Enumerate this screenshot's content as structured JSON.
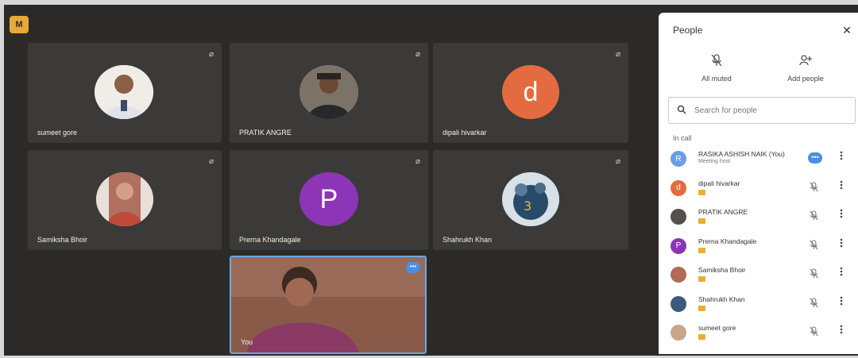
{
  "app": {
    "badge": "M"
  },
  "tiles": [
    {
      "name": "sumeet gore",
      "avatar_kind": "photo",
      "avatar_color": "#e9e4df"
    },
    {
      "name": "PRATIK ANGRE",
      "avatar_kind": "photo",
      "avatar_color": "#6f6a62"
    },
    {
      "name": "dipali hivarkar",
      "avatar_kind": "letter",
      "letter": "d",
      "avatar_color": "#e36b3f"
    },
    {
      "name": "Samiksha Bhoir",
      "avatar_kind": "photo",
      "avatar_color": "#c08070"
    },
    {
      "name": "Prerna Khandagale",
      "avatar_kind": "letter",
      "letter": "P",
      "avatar_color": "#8c35b7"
    },
    {
      "name": "Shahrukh Khan",
      "avatar_kind": "photo",
      "avatar_color": "#3a5a7a"
    }
  ],
  "self_tile": {
    "name": "You",
    "more": "•••"
  },
  "people_panel": {
    "title": "People",
    "close": "✕",
    "all_muted_label": "All muted",
    "add_people_label": "Add people",
    "search_placeholder": "Search for people",
    "section_label": "In call",
    "participants": [
      {
        "name": "RASIKA ASHISH NAIK (You)",
        "sub": "Meeting host",
        "letter": "R",
        "color": "#6b9de8",
        "kind": "letter",
        "action": "more"
      },
      {
        "name": "dipali hivarkar",
        "letter": "d",
        "color": "#e36b3f",
        "kind": "letter",
        "action": "muted"
      },
      {
        "name": "PRATIK ANGRE",
        "color": "#55504a",
        "kind": "photo",
        "action": "muted"
      },
      {
        "name": "Prerna Khandagale",
        "letter": "P",
        "color": "#8c35b7",
        "kind": "letter",
        "action": "muted"
      },
      {
        "name": "Samiksha Bhoir",
        "color": "#b06a55",
        "kind": "photo",
        "action": "muted"
      },
      {
        "name": "Shahrukh Khan",
        "color": "#3a5a7a",
        "kind": "photo",
        "action": "muted"
      },
      {
        "name": "sumeet gore",
        "color": "#c9a58a",
        "kind": "photo",
        "action": "muted"
      }
    ]
  },
  "icons": {
    "muted_mic": "mic-off-icon",
    "add_person": "person-add-icon",
    "search": "search-icon",
    "more_vert": "more-vert-icon"
  }
}
